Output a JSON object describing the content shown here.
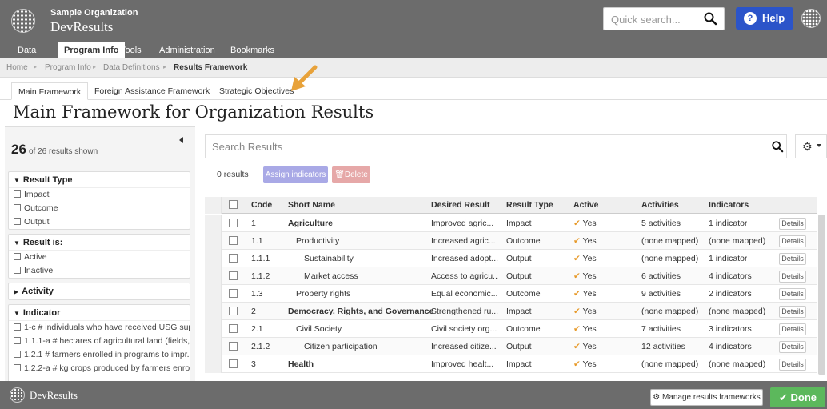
{
  "header": {
    "org_name": "Sample Organization",
    "app_name": "DevResults",
    "search_placeholder": "Quick search...",
    "help_label": "Help"
  },
  "nav": {
    "items": [
      "Data",
      "Program Info",
      "Tools",
      "Administration",
      "Bookmarks"
    ],
    "active": "Program Info"
  },
  "breadcrumb": [
    "Home",
    "Program Info",
    "Data Definitions",
    "Results Framework"
  ],
  "tabs": [
    "Main Framework",
    "Foreign Assistance Framework",
    "Strategic Objectives"
  ],
  "page_title": "Main Framework for Organization Results",
  "sidebar": {
    "count_num": "26",
    "count_text": "of 26 results shown",
    "filters": [
      {
        "title": "Result Type",
        "expanded": true,
        "options": [
          "Impact",
          "Outcome",
          "Output"
        ]
      },
      {
        "title": "Result is:",
        "expanded": true,
        "options": [
          "Active",
          "Inactive"
        ]
      },
      {
        "title": "Activity",
        "expanded": false,
        "options": []
      },
      {
        "title": "Indicator",
        "expanded": true,
        "options": [
          "1-c # individuals who have received USG sup...",
          "1.1.1-a # hectares of agricultural land (fields,...",
          "1.2.1 # farmers enrolled in programs to impr...",
          "1.2.2-a # kg crops produced by farmers enro..."
        ]
      }
    ]
  },
  "results": {
    "search_placeholder": "Search Results",
    "count_label": "0 results",
    "assign_label": "Assign indicators",
    "delete_label": "Delete"
  },
  "table": {
    "columns": [
      "Code",
      "Short Name",
      "Desired Result",
      "Result Type",
      "Active",
      "Activities",
      "Indicators"
    ],
    "details_label": "Details",
    "rows": [
      {
        "code": "1",
        "name": "Agriculture",
        "level": 0,
        "bold": true,
        "desired": "Improved agric...",
        "type": "Impact",
        "active": "Yes",
        "activities": "5 activities",
        "indicators": "1 indicator"
      },
      {
        "code": "1.1",
        "name": "Productivity",
        "level": 1,
        "bold": false,
        "desired": "Increased agric...",
        "type": "Outcome",
        "active": "Yes",
        "activities": "(none mapped)",
        "indicators": "(none mapped)"
      },
      {
        "code": "1.1.1",
        "name": "Sustainability",
        "level": 2,
        "bold": false,
        "desired": "Increased adopt...",
        "type": "Output",
        "active": "Yes",
        "activities": "(none mapped)",
        "indicators": "1 indicator"
      },
      {
        "code": "1.1.2",
        "name": "Market access",
        "level": 2,
        "bold": false,
        "desired": "Access to agricu...",
        "type": "Output",
        "active": "Yes",
        "activities": "6 activities",
        "indicators": "4 indicators"
      },
      {
        "code": "1.3",
        "name": "Property rights",
        "level": 1,
        "bold": false,
        "desired": "Equal economic...",
        "type": "Outcome",
        "active": "Yes",
        "activities": "9 activities",
        "indicators": "2 indicators"
      },
      {
        "code": "2",
        "name": "Democracy, Rights, and Governance",
        "level": 0,
        "bold": true,
        "desired": "Strengthened ru...",
        "type": "Impact",
        "active": "Yes",
        "activities": "(none mapped)",
        "indicators": "(none mapped)"
      },
      {
        "code": "2.1",
        "name": "Civil Society",
        "level": 1,
        "bold": false,
        "desired": "Civil society org...",
        "type": "Outcome",
        "active": "Yes",
        "activities": "7 activities",
        "indicators": "3 indicators"
      },
      {
        "code": "2.1.2",
        "name": "Citizen participation",
        "level": 2,
        "bold": false,
        "desired": "Increased citize...",
        "type": "Output",
        "active": "Yes",
        "activities": "12 activities",
        "indicators": "4 indicators"
      },
      {
        "code": "3",
        "name": "Health",
        "level": 0,
        "bold": true,
        "desired": "Improved healt...",
        "type": "Impact",
        "active": "Yes",
        "activities": "(none mapped)",
        "indicators": "(none mapped)"
      }
    ]
  },
  "footer": {
    "app_name": "DevResults",
    "manage_label": "Manage results frameworks",
    "done_label": "Done"
  },
  "colors": {
    "header_bg": "#6c6c6c",
    "help_blue": "#2b54c9",
    "check_orange": "#e79b2c",
    "done_green": "#5cb85c",
    "arrow": "#e8a23a"
  }
}
